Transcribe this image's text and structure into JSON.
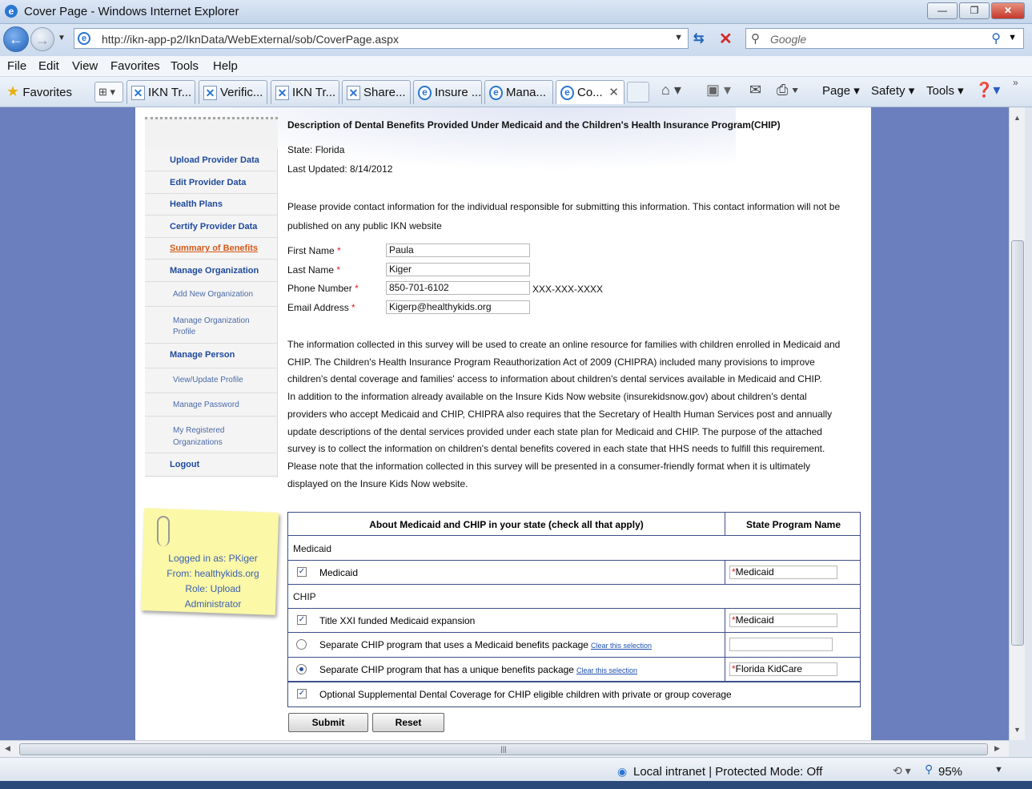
{
  "window": {
    "title": "Cover Page - Windows Internet Explorer",
    "minimize": "—",
    "maximize": "❐",
    "close": "✕"
  },
  "address": {
    "url": "http://ikn-app-p2/IknData/WebExternal/sob/CoverPage.aspx",
    "search_placeholder": "Google"
  },
  "menu": [
    "File",
    "Edit",
    "View",
    "Favorites",
    "Tools",
    "Help"
  ],
  "tabs": {
    "favorites_label": "Favorites",
    "items": [
      {
        "label": "IKN Tr...",
        "icon": "x"
      },
      {
        "label": "Verific...",
        "icon": "x"
      },
      {
        "label": "IKN Tr...",
        "icon": "x"
      },
      {
        "label": "Share...",
        "icon": "x"
      },
      {
        "label": "Insure ...",
        "icon": "ie"
      },
      {
        "label": "Mana...",
        "icon": "ie"
      },
      {
        "label": "Co...",
        "icon": "ie"
      }
    ],
    "commands": {
      "page": "Page ▾",
      "safety": "Safety ▾",
      "tools": "Tools ▾"
    }
  },
  "sidebar": {
    "items": [
      {
        "label": "Upload Provider Data"
      },
      {
        "label": "Edit Provider Data"
      },
      {
        "label": "Health Plans"
      },
      {
        "label": "Certify Provider Data"
      },
      {
        "label": "Summary of Benefits"
      },
      {
        "label": "Manage Organization"
      },
      {
        "label": "Add New Organization"
      },
      {
        "label": "Manage Organization",
        "label2": "Profile"
      },
      {
        "label": "Manage Person"
      },
      {
        "label": "View/Update Profile"
      },
      {
        "label": "Manage Password"
      },
      {
        "label": "My Registered",
        "label2": "Organizations"
      },
      {
        "label": "Logout"
      }
    ],
    "sticky": {
      "line1": "Logged in as: PKiger",
      "line2": "From: healthykids.org",
      "line3": "Role: Upload",
      "line4": "Administrator"
    }
  },
  "main": {
    "heading": "Description of Dental Benefits Provided Under Medicaid and the Children's Health Insurance Program(CHIP)",
    "state": "State: Florida",
    "last_updated": "Last Updated: 8/14/2012",
    "contact_intro_1": "Please provide contact information for the individual responsible for submitting this information. This contact information will not be",
    "contact_intro_2": "published on any public IKN website",
    "fields": {
      "first_name_label": "First Name",
      "first_name": "Paula",
      "last_name_label": "Last Name",
      "last_name": "Kiger",
      "phone_label": "Phone Number",
      "phone": "850-701-6102",
      "phone_hint": "XXX-XXX-XXXX",
      "email_label": "Email Address",
      "email": "Kigerp@healthykids.org",
      "required_mark": "*"
    },
    "paragraph": [
      "The information collected in this survey will be used to create an online resource for families with children enrolled in Medicaid and",
      "CHIP. The Children's Health Insurance Program Reauthorization Act of 2009 (CHIPRA) included many provisions to improve",
      "children's dental coverage and families' access to information about children's dental services available in Medicaid and CHIP.",
      "In addition to the information already available on the Insure Kids Now website (insurekidsnow.gov) about children's dental",
      "providers who accept Medicaid and CHIP, CHIPRA also requires that the Secretary of Health Human Services post and annually",
      "update descriptions of the dental services provided under each state plan for Medicaid and CHIP. The purpose of the attached",
      "survey is to collect the information on children's dental benefits covered in each state that HHS needs to fulfill this requirement.",
      "Please note that the information collected in this survey will be presented in a consumer-friendly format when it is ultimately",
      "displayed on the Insure Kids Now website."
    ],
    "table": {
      "col1": "About Medicaid and CHIP in your state (check all that apply)",
      "col2": "State Program Name",
      "medicaid_section": "Medicaid",
      "chip_section": "CHIP",
      "rows": [
        {
          "label": "Medicaid",
          "name": "Medicaid"
        },
        {
          "label": "Title XXI funded Medicaid expansion",
          "name": "Medicaid"
        },
        {
          "label": "Separate CHIP program that uses a Medicaid benefits package",
          "clear": "Clear this selection",
          "name": ""
        },
        {
          "label": "Separate CHIP program that has a unique benefits package",
          "clear": "Clear this selection",
          "name": "Florida KidCare"
        },
        {
          "label": "Optional Supplemental Dental Coverage for CHIP eligible children with private or group coverage"
        }
      ]
    },
    "submit": "Submit",
    "reset": "Reset"
  },
  "status": {
    "zone": "Local intranet | Protected Mode: Off",
    "zoom": "95%"
  }
}
